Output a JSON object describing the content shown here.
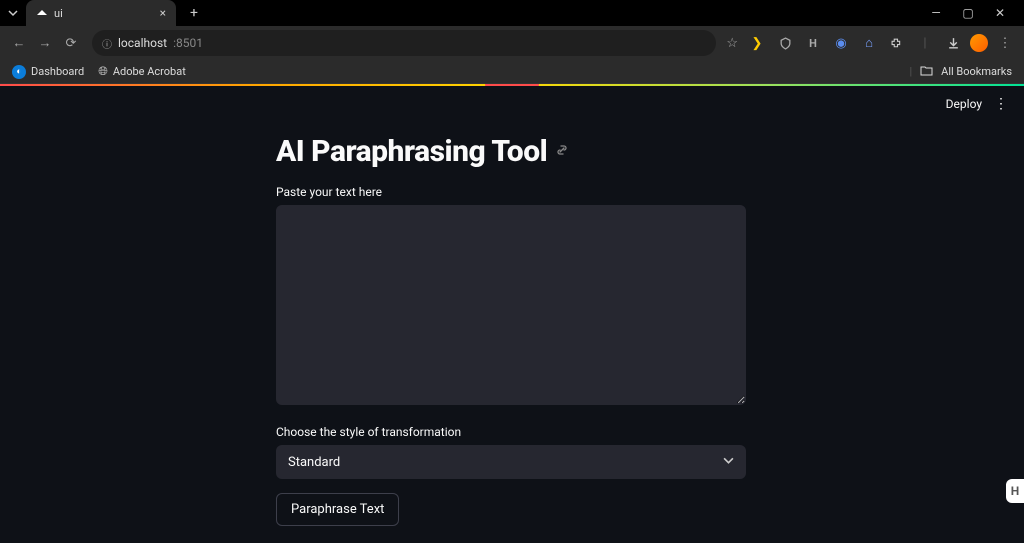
{
  "browser": {
    "tab_title": "ui",
    "url_host": "localhost",
    "url_port": ":8501",
    "bookmarks": [
      {
        "label": "Dashboard"
      },
      {
        "label": "Adobe Acrobat"
      }
    ],
    "all_bookmarks": "All Bookmarks"
  },
  "app": {
    "deploy": "Deploy",
    "title": "AI Paraphrasing Tool",
    "text_label": "Paste your text here",
    "text_value": "",
    "style_label": "Choose the style of transformation",
    "style_selected": "Standard",
    "button": "Paraphrase Text"
  }
}
